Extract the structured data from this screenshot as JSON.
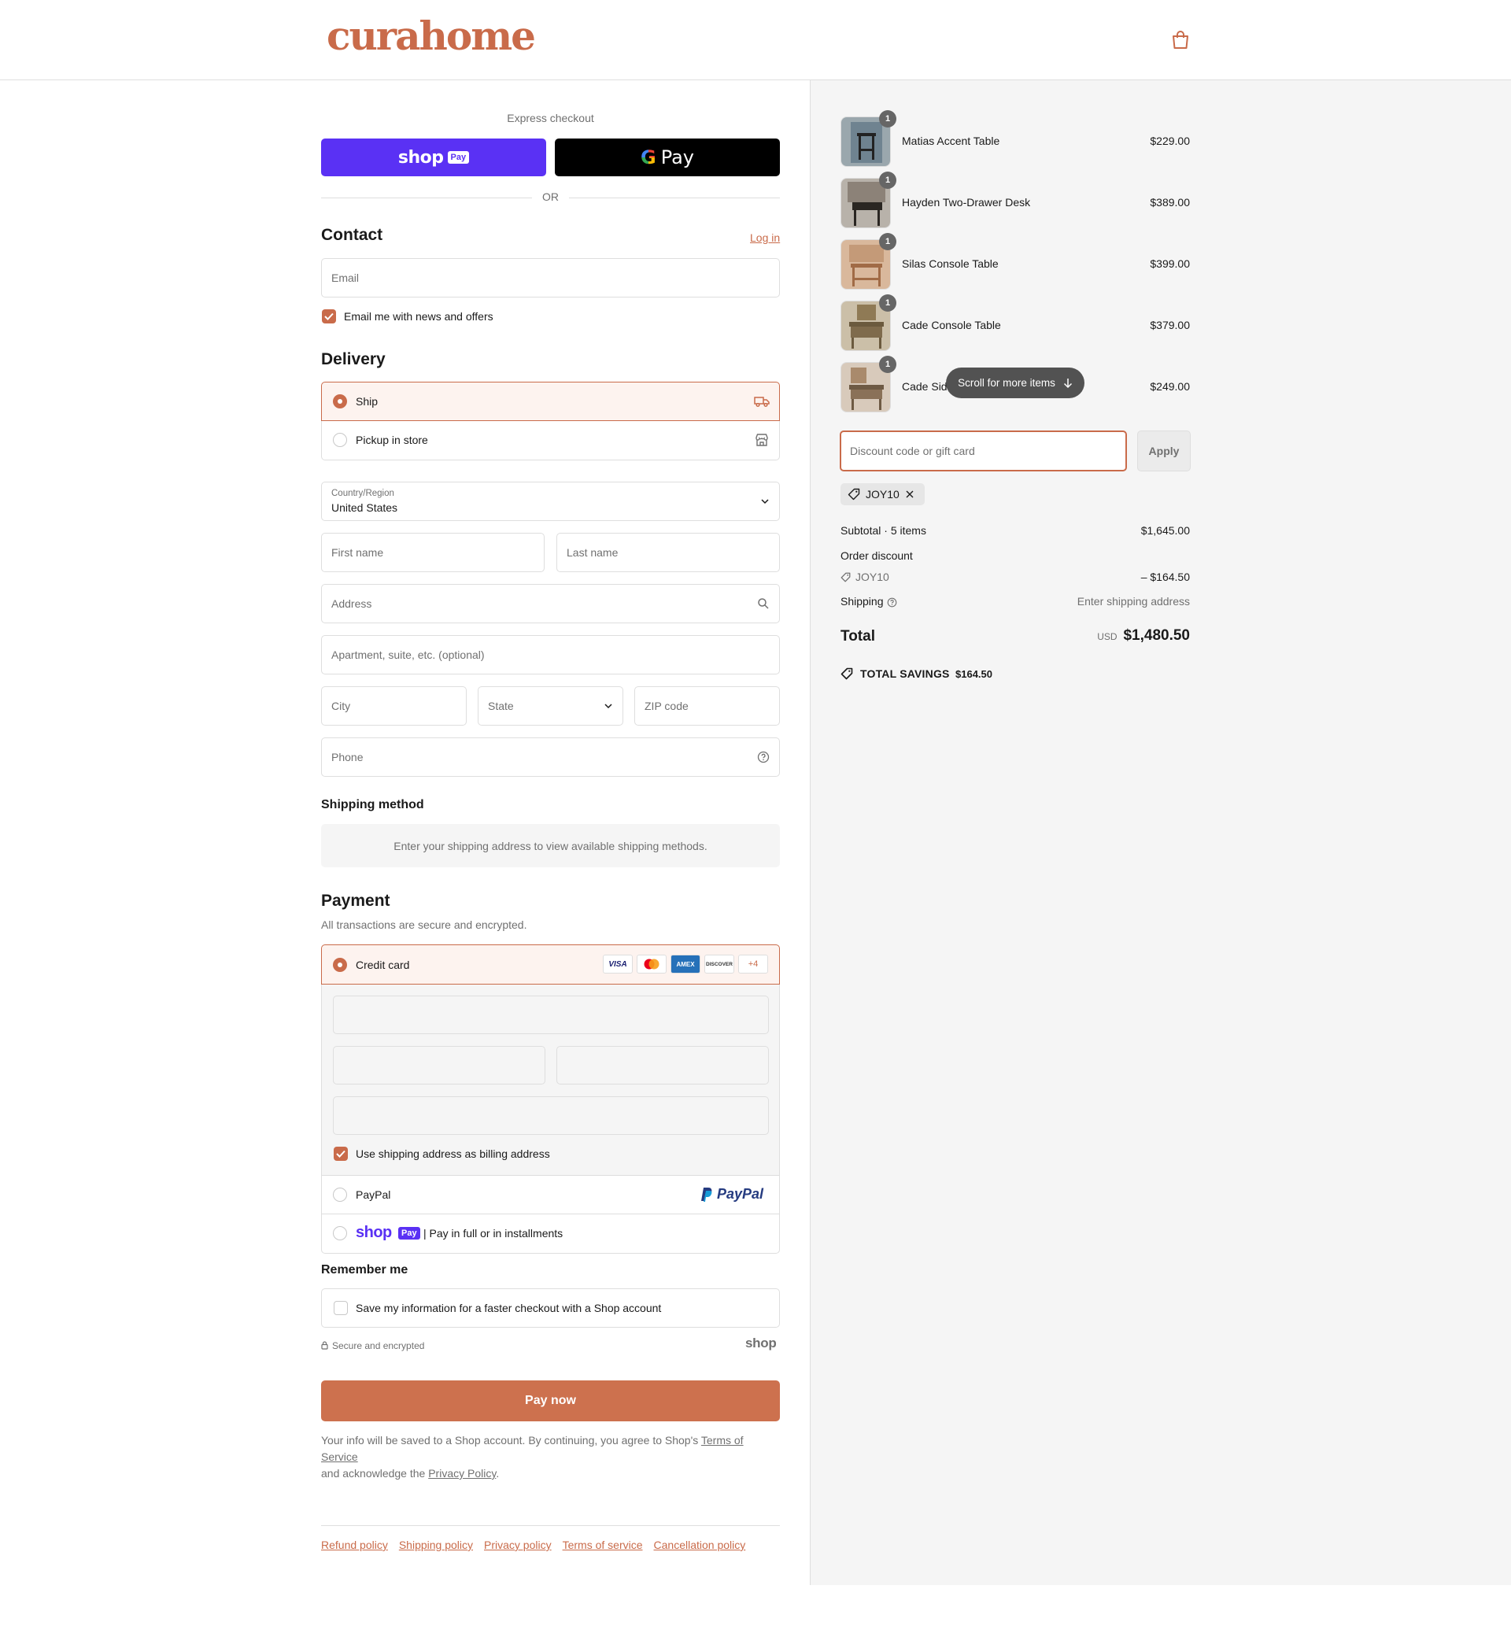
{
  "header": {
    "logo_text": "curahome",
    "cart_icon": "bag-icon"
  },
  "express": {
    "label": "Express checkout",
    "shop_word": "shop",
    "shop_pay_chip": "Pay",
    "gpay_word": "Pay",
    "or_label": "OR"
  },
  "contact": {
    "title": "Contact",
    "login_link": "Log in",
    "email_placeholder": "Email",
    "news_label": "Email me with news and offers"
  },
  "delivery": {
    "title": "Delivery",
    "options": [
      {
        "label": "Ship",
        "icon": "truck-icon"
      },
      {
        "label": "Pickup in store",
        "icon": "store-icon"
      }
    ],
    "country_label": "Country/Region",
    "country_value": "United States",
    "first_name": "First name",
    "last_name": "Last name",
    "address": "Address",
    "apartment": "Apartment, suite, etc. (optional)",
    "city": "City",
    "state": "State",
    "zip": "ZIP code",
    "phone": "Phone"
  },
  "shipping_method": {
    "title": "Shipping method",
    "message": "Enter your shipping address to view available shipping methods."
  },
  "payment": {
    "title": "Payment",
    "subtitle": "All transactions are secure and encrypted.",
    "credit_card_label": "Credit card",
    "card_logos": [
      "VISA",
      "MC",
      "AMEX",
      "DISCOVER"
    ],
    "more_cards": "+4",
    "billing_label": "Use shipping address as billing address",
    "paypal_label": "PayPal",
    "paypal_logo": "PayPal",
    "shoppay_word": "shop",
    "shoppay_chip": "Pay",
    "shoppay_label": "| Pay in full or in installments"
  },
  "remember": {
    "title": "Remember me",
    "save_label": "Save my information for a faster checkout with a Shop account",
    "secure_label": "Secure and encrypted",
    "shop_brand": "shop"
  },
  "pay_now": "Pay now",
  "footnote": {
    "text_1": "Your info will be saved to a Shop account. By continuing, you agree to Shop's ",
    "terms": "Terms of Service",
    "text_2": "and acknowledge the ",
    "privacy": "Privacy Policy",
    "text_3": "."
  },
  "footer_links": [
    "Refund policy",
    "Shipping policy",
    "Privacy policy",
    "Terms of service",
    "Cancellation policy"
  ],
  "order": {
    "items": [
      {
        "name": "Matias Accent Table",
        "price": "$229.00",
        "qty": "1"
      },
      {
        "name": "Hayden Two-Drawer Desk",
        "price": "$389.00",
        "qty": "1"
      },
      {
        "name": "Silas Console Table",
        "price": "$399.00",
        "qty": "1"
      },
      {
        "name": "Cade Console Table",
        "price": "$379.00",
        "qty": "1"
      },
      {
        "name": "Cade Sid",
        "price": "$249.00",
        "qty": "1"
      }
    ],
    "scroll_hint": "Scroll for more items",
    "discount_placeholder": "Discount code or gift card",
    "apply_label": "Apply",
    "applied_code": "JOY10",
    "subtotal_label": "Subtotal · 5 items",
    "subtotal_value": "$1,645.00",
    "order_discount_label": "Order discount",
    "discount_code": "JOY10",
    "discount_value": "– $164.50",
    "shipping_label": "Shipping",
    "shipping_value": "Enter shipping address",
    "total_label": "Total",
    "currency": "USD",
    "total_value": "$1,480.50",
    "savings_label": "TOTAL SAVINGS",
    "savings_value": "$164.50"
  },
  "colors": {
    "accent": "#c96b4a",
    "shop_purple": "#5a31f4",
    "panel_bg": "#f5f5f5"
  }
}
